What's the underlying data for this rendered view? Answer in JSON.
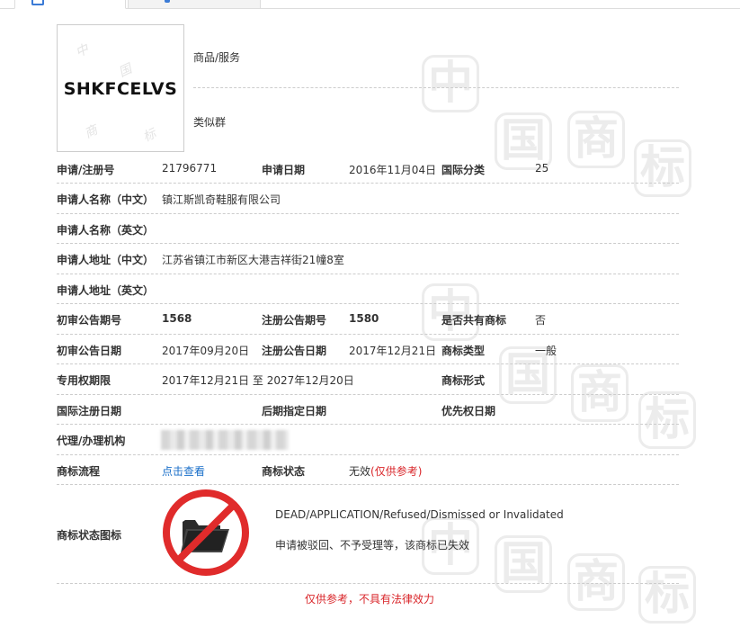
{
  "trademark": {
    "logo_text": "SHKFCELVS",
    "goods_services_label": "商品/服务",
    "similar_group_label": "类似群"
  },
  "rows": {
    "reg_no_label": "申请/注册号",
    "reg_no_value": "21796771",
    "app_date_label": "申请日期",
    "app_date_value": "2016年11月04日",
    "intl_class_label": "国际分类",
    "intl_class_value": "25",
    "applicant_cn_label": "申请人名称（中文）",
    "applicant_cn_value": "镇江斯凯奇鞋服有限公司",
    "applicant_en_label": "申请人名称（英文）",
    "address_cn_label": "申请人地址（中文）",
    "address_cn_value": "江苏省镇江市新区大港吉祥街21幢8室",
    "address_en_label": "申请人地址（英文）",
    "prelim_issue_label": "初审公告期号",
    "prelim_issue_value": "1568",
    "reg_issue_label": "注册公告期号",
    "reg_issue_value": "1580",
    "shared_label": "是否共有商标",
    "shared_value": "否",
    "prelim_date_label": "初审公告日期",
    "prelim_date_value": "2017年09月20日",
    "reg_date_label": "注册公告日期",
    "reg_date_value": "2017年12月21日",
    "tm_type_label": "商标类型",
    "tm_type_value": "一般",
    "exclusive_label": "专用权期限",
    "exclusive_value": "2017年12月21日 至 2027年12月20日",
    "tm_form_label": "商标形式",
    "intl_reg_date_label": "国际注册日期",
    "later_designation_label": "后期指定日期",
    "priority_date_label": "优先权日期",
    "agency_label": "代理/办理机构",
    "flow_label": "商标流程",
    "flow_link": "点击查看",
    "status_label": "商标状态",
    "status_value": "无效",
    "status_note": "(仅供参考)",
    "status_icon_label": "商标状态图标"
  },
  "status_detail": {
    "en": "DEAD/APPLICATION/Refused/Dismissed or Invalidated",
    "cn": "申请被驳回、不予受理等，该商标已失效"
  },
  "footer": {
    "disclaimer": "仅供参考，不具有法律效力"
  },
  "watermark": {
    "glyphs": [
      "中",
      "国",
      "商",
      "标"
    ]
  },
  "colors": {
    "link": "#1a6fc9",
    "warning": "#d9262a",
    "prohibited": "#e02b2b"
  },
  "icons": {
    "tab1": "document-icon",
    "tab2": "chart-icon",
    "status": "prohibited-folder-icon"
  }
}
